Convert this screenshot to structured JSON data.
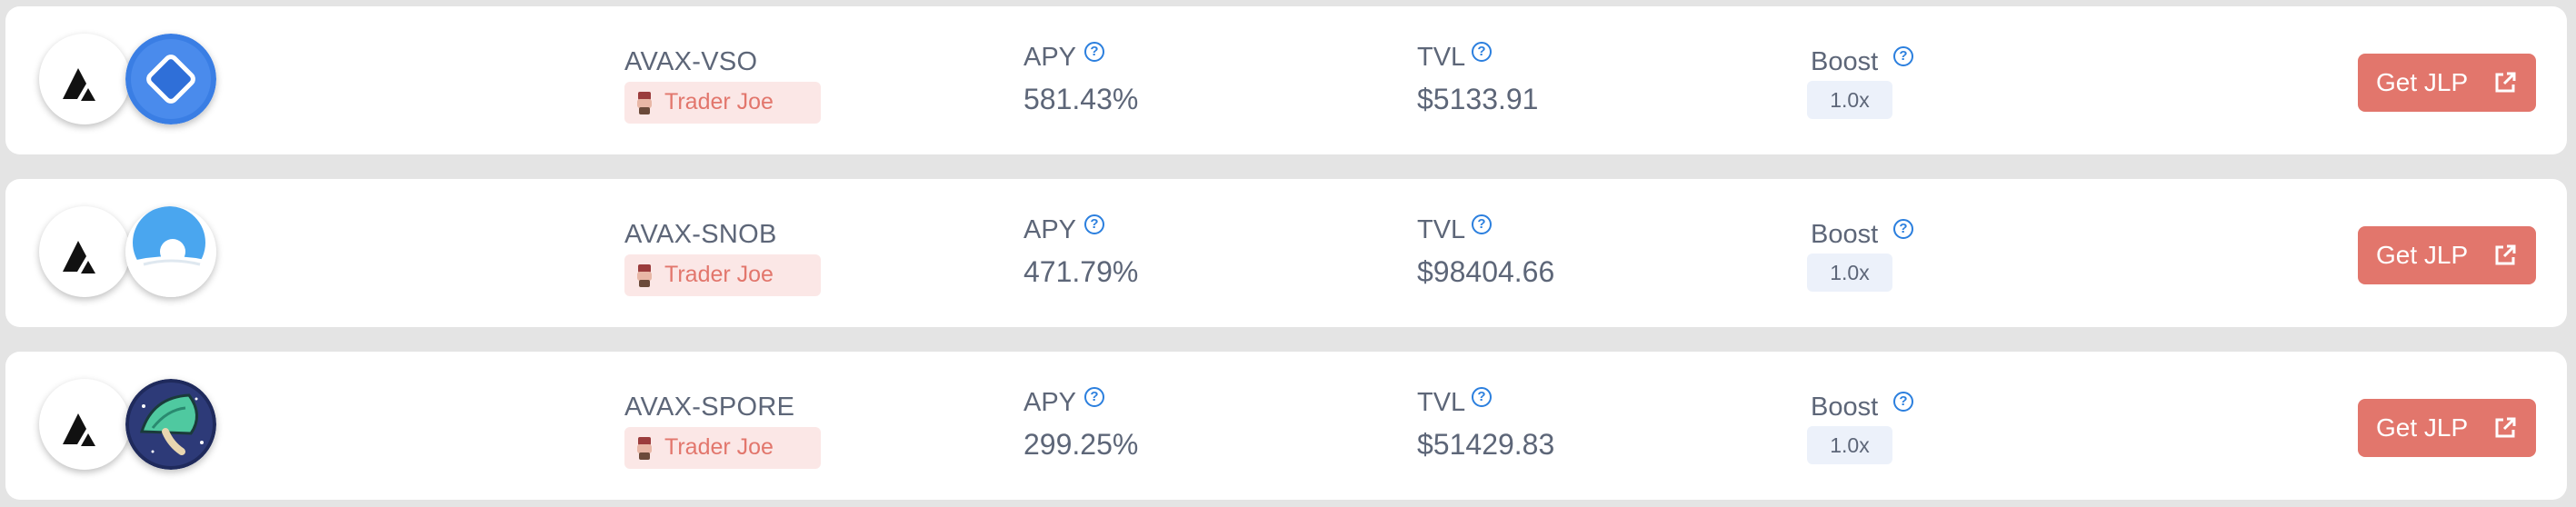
{
  "farms": [
    {
      "pair": "AVAX-VSO",
      "dex": "Trader Joe",
      "apy_label": "APY",
      "apy": "581.43%",
      "tvl_label": "TVL",
      "tvl": "$5133.91",
      "boost_label": "Boost",
      "boost": "1.0x",
      "button_label": "Get JLP",
      "base_icon": "avalanche-logo",
      "token_icon": "vso-diamond-logo"
    },
    {
      "pair": "AVAX-SNOB",
      "dex": "Trader Joe",
      "apy_label": "APY",
      "apy": "471.79%",
      "tvl_label": "TVL",
      "tvl": "$98404.66",
      "boost_label": "Boost",
      "boost": "1.0x",
      "button_label": "Get JLP",
      "base_icon": "avalanche-logo",
      "token_icon": "snowball-logo"
    },
    {
      "pair": "AVAX-SPORE",
      "dex": "Trader Joe",
      "apy_label": "APY",
      "apy": "299.25%",
      "tvl_label": "TVL",
      "tvl": "$51429.83",
      "boost_label": "Boost",
      "boost": "1.0x",
      "button_label": "Get JLP",
      "base_icon": "avalanche-logo",
      "token_icon": "spore-mushroom-logo"
    }
  ],
  "colors": {
    "page_bg": "#e4e4e4",
    "card_bg": "#ffffff",
    "text": "#5d6678",
    "accent": "#e2766c",
    "badge_bg": "#fbe7e6",
    "help_icon": "#2b7fde",
    "boost_bg": "#ecf1fa"
  }
}
